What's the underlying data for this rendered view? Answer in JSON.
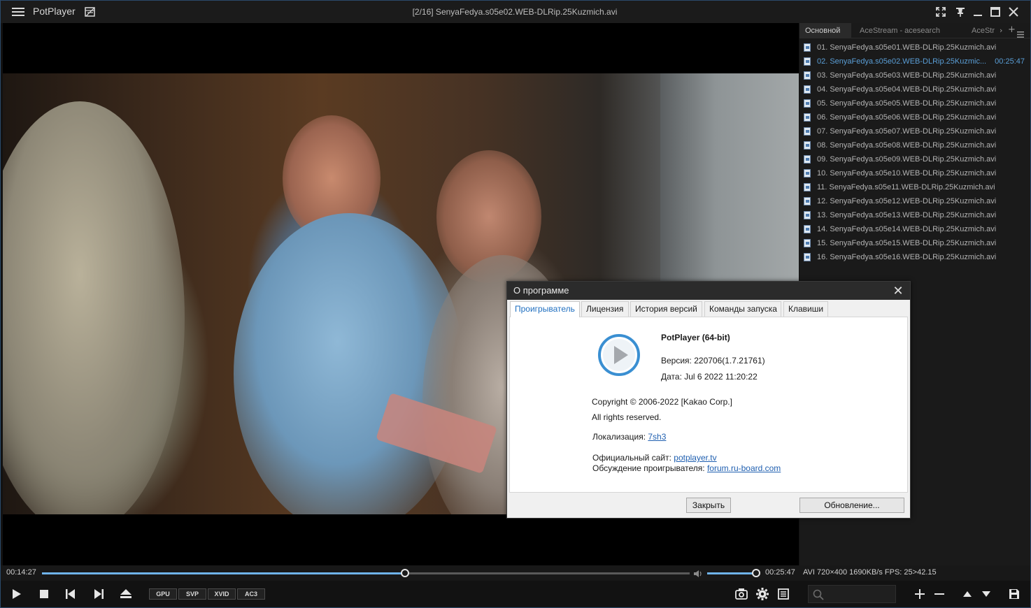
{
  "titlebar": {
    "app_name": "PotPlayer",
    "window_title": "[2/16] SenyaFedya.s05e02.WEB-DLRip.25Kuzmich.avi",
    "icons": [
      "menu-icon",
      "playlist-toggle-icon",
      "fullscreen-icon",
      "pin-icon",
      "minimize-icon",
      "maximize-icon",
      "close-icon"
    ]
  },
  "playlist": {
    "tabs": [
      "Основной",
      "AceStream - acesearch",
      "AceStr"
    ],
    "items": [
      {
        "label": "01. SenyaFedya.s05e01.WEB-DLRip.25Kuzmich.avi",
        "duration": ""
      },
      {
        "label": "02. SenyaFedya.s05e02.WEB-DLRip.25Kuzmic...",
        "duration": "00:25:47"
      },
      {
        "label": "03. SenyaFedya.s05e03.WEB-DLRip.25Kuzmich.avi",
        "duration": ""
      },
      {
        "label": "04. SenyaFedya.s05e04.WEB-DLRip.25Kuzmich.avi",
        "duration": ""
      },
      {
        "label": "05. SenyaFedya.s05e05.WEB-DLRip.25Kuzmich.avi",
        "duration": ""
      },
      {
        "label": "06. SenyaFedya.s05e06.WEB-DLRip.25Kuzmich.avi",
        "duration": ""
      },
      {
        "label": "07. SenyaFedya.s05e07.WEB-DLRip.25Kuzmich.avi",
        "duration": ""
      },
      {
        "label": "08. SenyaFedya.s05e08.WEB-DLRip.25Kuzmich.avi",
        "duration": ""
      },
      {
        "label": "09. SenyaFedya.s05e09.WEB-DLRip.25Kuzmich.avi",
        "duration": ""
      },
      {
        "label": "10. SenyaFedya.s05e10.WEB-DLRip.25Kuzmich.avi",
        "duration": ""
      },
      {
        "label": "11. SenyaFedya.s05e11.WEB-DLRip.25Kuzmich.avi",
        "duration": ""
      },
      {
        "label": "12. SenyaFedya.s05e12.WEB-DLRip.25Kuzmich.avi",
        "duration": ""
      },
      {
        "label": "13. SenyaFedya.s05e13.WEB-DLRip.25Kuzmich.avi",
        "duration": ""
      },
      {
        "label": "14. SenyaFedya.s05e14.WEB-DLRip.25Kuzmich.avi",
        "duration": ""
      },
      {
        "label": "15. SenyaFedya.s05e15.WEB-DLRip.25Kuzmich.avi",
        "duration": ""
      },
      {
        "label": "16. SenyaFedya.s05e16.WEB-DLRip.25Kuzmich.avi",
        "duration": ""
      }
    ],
    "current_index": 1
  },
  "about": {
    "title": "О программе",
    "tabs": [
      "Проигрыватель",
      "Лицензия",
      "История версий",
      "Команды запуска",
      "Клавиши"
    ],
    "product": "PotPlayer (64-bit)",
    "version": "Версия: 220706(1.7.21761)",
    "date": "Дата: Jul  6 2022 11:20:22",
    "copyright": "Copyright © 2006-2022 [Kakao Corp.]",
    "rights": "All rights reserved.",
    "localization_label": "Локализация:",
    "localization_link": "7sh3",
    "site_label": "Официальный сайт:",
    "site_link": "potplayer.tv",
    "forum_label": "Обсуждение проигрывателя:",
    "forum_link": "forum.ru-board.com",
    "close_button": "Закрыть",
    "update_button": "Обновление..."
  },
  "seek": {
    "current_time": "00:14:27",
    "total_time": "00:25:47",
    "progress": 0.56,
    "volume": 1.0,
    "media_info": "AVI   720×400  1690KB/s  FPS: 25>42.15"
  },
  "controls": {
    "codecs": [
      "GPU",
      "SVP",
      "XVID",
      "AC3"
    ],
    "icons": [
      "play-icon",
      "stop-icon",
      "previous-icon",
      "next-icon",
      "eject-icon",
      "camera-icon",
      "settings-icon",
      "playlist-icon",
      "search-icon",
      "add-icon",
      "remove-icon",
      "move-up-icon",
      "move-down-icon",
      "save-icon"
    ]
  },
  "colors": {
    "accent": "#6fb3ea",
    "current_item": "#5a9ed6",
    "link": "#1f5fb0"
  }
}
